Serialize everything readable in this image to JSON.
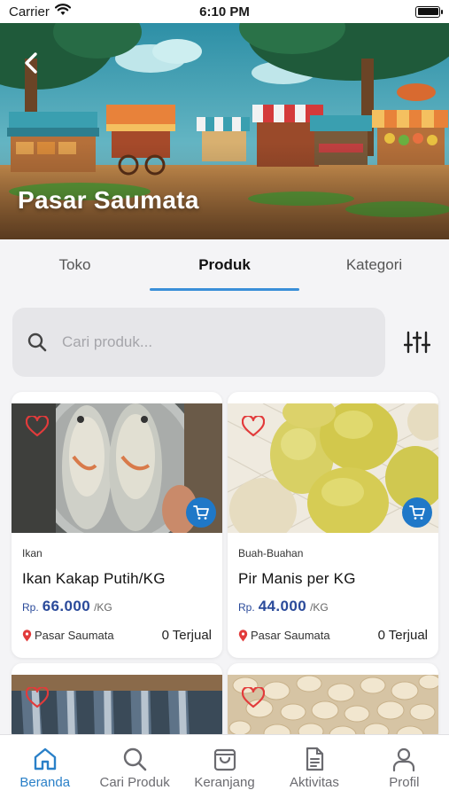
{
  "status_bar": {
    "carrier": "Carrier",
    "time": "6:10 PM"
  },
  "hero": {
    "title": "Pasar Saumata"
  },
  "tabs": [
    {
      "label": "Toko",
      "active": false
    },
    {
      "label": "Produk",
      "active": true
    },
    {
      "label": "Kategori",
      "active": false
    }
  ],
  "search": {
    "placeholder": "Cari produk...",
    "value": ""
  },
  "products": [
    {
      "category": "Ikan",
      "name": "Ikan Kakap Putih/KG",
      "currency": "Rp.",
      "price": "66.000",
      "unit": "/KG",
      "location": "Pasar Saumata",
      "sold": "0 Terjual"
    },
    {
      "category": "Buah-Buahan",
      "name": "Pir Manis per KG",
      "currency": "Rp.",
      "price": "44.000",
      "unit": "/KG",
      "location": "Pasar Saumata",
      "sold": "0 Terjual"
    }
  ],
  "bottom_nav": [
    {
      "label": "Beranda",
      "icon": "home-icon",
      "active": true
    },
    {
      "label": "Cari Produk",
      "icon": "search-icon",
      "active": false
    },
    {
      "label": "Keranjang",
      "icon": "shopping-bag-icon",
      "active": false
    },
    {
      "label": "Aktivitas",
      "icon": "document-icon",
      "active": false
    },
    {
      "label": "Profil",
      "icon": "user-icon",
      "active": false
    }
  ],
  "colors": {
    "accent": "#1f78c8",
    "price": "#2a4a9a",
    "favorite": "#e23b3b",
    "location_pin": "#e23b3b"
  }
}
